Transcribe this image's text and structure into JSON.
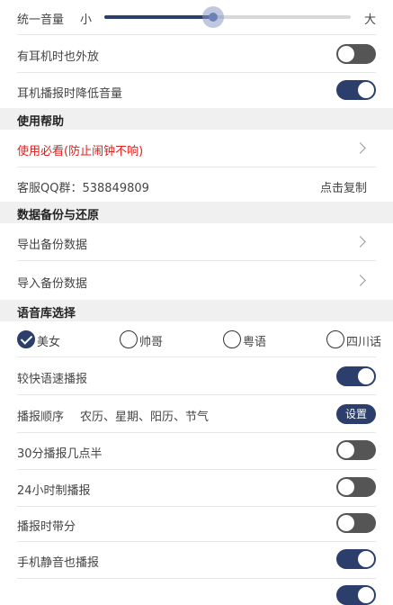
{
  "volume": {
    "label": "统一音量",
    "min_label": "小",
    "max_label": "大",
    "level_percent": 44
  },
  "settings": {
    "earphone_speaker": {
      "label": "有耳机时也外放",
      "on": false
    },
    "earphone_lower": {
      "label": "耳机播报时降低音量",
      "on": true
    }
  },
  "help": {
    "title": "使用帮助",
    "must_read": "使用必看(防止闹钟不响)",
    "qq_label": "客服QQ群：538849809",
    "copy_label": "点击复制"
  },
  "backup": {
    "title": "数据备份与还原",
    "export_label": "导出备份数据",
    "import_label": "导入备份数据"
  },
  "voice": {
    "title": "语音库选择",
    "options": [
      "美女",
      "帅哥",
      "粤语",
      "四川话"
    ],
    "selected": "美女"
  },
  "options": {
    "fast_speech": {
      "label": "较快语速播报",
      "on": true
    },
    "order_label": "播报顺序",
    "order_value": "农历、星期、阳历、节气",
    "order_button": "设置",
    "half_hour": {
      "label": "30分播报几点半",
      "on": false
    },
    "h24": {
      "label": "24小时制播报",
      "on": false
    },
    "with_minutes": {
      "label": "播报时带分",
      "on": false
    },
    "silent_mode": {
      "label": "手机静音也播报",
      "on": true
    }
  },
  "colors": {
    "accent": "#2c3e6b",
    "warning_text": "#e0201c",
    "toggle_off": "#555555"
  }
}
